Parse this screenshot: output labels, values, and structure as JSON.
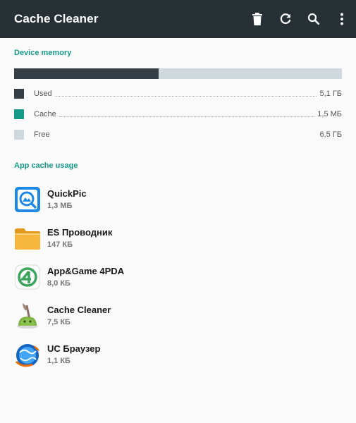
{
  "toolbar": {
    "title": "Cache Cleaner",
    "actions": [
      {
        "icon": "trash-icon"
      },
      {
        "icon": "refresh-icon"
      },
      {
        "icon": "search-icon"
      },
      {
        "icon": "more-vert-icon"
      }
    ]
  },
  "device_memory": {
    "header": "Device memory",
    "used_fraction": 0.44,
    "legend": [
      {
        "label": "Used",
        "value": "5,1 ГБ",
        "color": "#353e45"
      },
      {
        "label": "Cache",
        "value": "1,5 МБ",
        "color": "#169a8a"
      },
      {
        "label": "Free",
        "value": "6,5 ГБ",
        "color": "#cfd8dc"
      }
    ]
  },
  "app_cache": {
    "header": "App cache usage",
    "apps": [
      {
        "name": "QuickPic",
        "size": "1,3 МБ",
        "icon": "quickpic-icon"
      },
      {
        "name": "ES Проводник",
        "size": "147 КБ",
        "icon": "folder-icon"
      },
      {
        "name": "App&Game 4PDA",
        "size": "8,0 КБ",
        "icon": "4pda-icon"
      },
      {
        "name": "Cache Cleaner",
        "size": "7,5 КБ",
        "icon": "cache-cleaner-icon"
      },
      {
        "name": "UC Браузер",
        "size": "1,1 КБ",
        "icon": "uc-browser-icon"
      }
    ]
  },
  "colors": {
    "appbar": "#263035",
    "accent": "#169a8a",
    "background": "#fafafa"
  }
}
